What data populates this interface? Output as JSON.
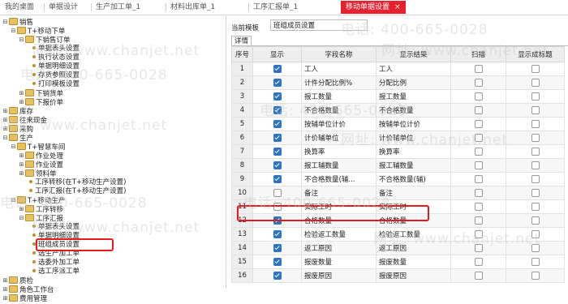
{
  "tabs": [
    {
      "label": "我的桌面",
      "active": false
    },
    {
      "label": "单据设计",
      "active": false
    },
    {
      "label": "生产加工单_1",
      "active": false
    },
    {
      "label": "材料出库单_1",
      "active": false
    },
    {
      "label": "工序汇报单_1",
      "active": false
    },
    {
      "label": "移动单据设置",
      "active": true
    }
  ],
  "tab_close": "×",
  "tree": {
    "n1": "销售",
    "n2": "T+移动下单",
    "n3": "下销售订单",
    "n4": "单据表头设置",
    "n5": "执行状态设置",
    "n6": "单据明细设置",
    "n7": "存货参照设置",
    "n8": "打印模板设置",
    "n9": "下销货单",
    "n10": "下报价单",
    "n11": "库存",
    "n12": "往来现金",
    "n13": "采购",
    "n14": "生产",
    "n15": "T+智慧车间",
    "n16": "作业处理",
    "n17": "作业设置",
    "n18": "领料单",
    "n19": "工序转移(在T+移动生产设置)",
    "n20": "工序汇报(在T+移动生产设置)",
    "n21": "T+移动生产",
    "n22": "工序转移",
    "n23": "工序汇报",
    "n24": "单据表头设置",
    "n25": "单据明细设置",
    "n26": "班组成员设置",
    "n27": "选生产加工单",
    "n28": "选委外加工单",
    "n29": "选工序派工单",
    "n30": "质检",
    "n31": "角色工作台",
    "n32": "费用管理"
  },
  "template": {
    "label": "当前模板",
    "value": "班组成员设置"
  },
  "detail_tab": "详情",
  "columns": [
    "序号",
    "显示",
    "字段名称",
    "显示结果",
    "扫描",
    "显示成标题"
  ],
  "rows": [
    {
      "no": "1",
      "show": true,
      "field": "工人",
      "result": "工人",
      "scan": false,
      "title": false
    },
    {
      "no": "2",
      "show": true,
      "field": "计件分配比例%",
      "result": "分配比例",
      "scan": false,
      "title": false
    },
    {
      "no": "3",
      "show": true,
      "field": "报工数量",
      "result": "报工数量",
      "scan": false,
      "title": false
    },
    {
      "no": "4",
      "show": true,
      "field": "不合格数量",
      "result": "不合格数量",
      "scan": false,
      "title": false
    },
    {
      "no": "5",
      "show": true,
      "field": "按辅单位计价",
      "result": "按辅单位计价",
      "scan": false,
      "title": false
    },
    {
      "no": "6",
      "show": true,
      "field": "计价辅单位",
      "result": "计价辅单位",
      "scan": false,
      "title": false
    },
    {
      "no": "7",
      "show": true,
      "field": "换算率",
      "result": "换算率",
      "scan": false,
      "title": false
    },
    {
      "no": "8",
      "show": true,
      "field": "报工辅数量",
      "result": "报工辅数量",
      "scan": false,
      "title": false
    },
    {
      "no": "9",
      "show": true,
      "field": "不合格数量(辅...",
      "result": "不合格数量(辅)",
      "scan": false,
      "title": false
    },
    {
      "no": "10",
      "show": false,
      "field": "备注",
      "result": "备注",
      "scan": false,
      "title": false
    },
    {
      "no": "11",
      "show": false,
      "field": "实际工时",
      "result": "实际工时",
      "scan": false,
      "title": false
    },
    {
      "no": "12",
      "show": true,
      "field": "合格数量",
      "result": "合格数量",
      "scan": false,
      "title": false
    },
    {
      "no": "13",
      "show": true,
      "field": "检验返工数量",
      "result": "检验返工数量",
      "scan": false,
      "title": false
    },
    {
      "no": "14",
      "show": true,
      "field": "返工原因",
      "result": "返工原因",
      "scan": false,
      "title": false
    },
    {
      "no": "15",
      "show": true,
      "field": "报废数量",
      "result": "报废数量",
      "scan": false,
      "title": false
    },
    {
      "no": "16",
      "show": true,
      "field": "报废原因",
      "result": "报废原因",
      "scan": false,
      "title": false
    }
  ],
  "watermark": {
    "phone": "电话: 400-665-0028",
    "site": "网址: www.chanjet.net"
  },
  "colors": {
    "accent": "#e8212f",
    "highlight": "#e41b1b",
    "checkbox": "#2b74c8"
  }
}
